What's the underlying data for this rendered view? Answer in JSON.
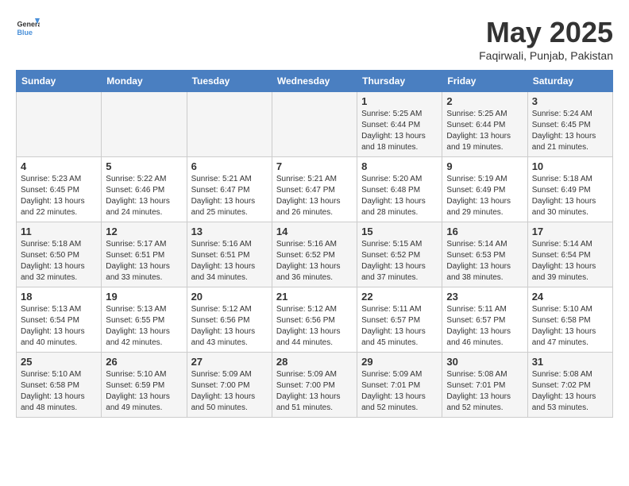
{
  "logo": {
    "line1": "General",
    "line2": "Blue"
  },
  "title": "May 2025",
  "subtitle": "Faqirwali, Punjab, Pakistan",
  "weekdays": [
    "Sunday",
    "Monday",
    "Tuesday",
    "Wednesday",
    "Thursday",
    "Friday",
    "Saturday"
  ],
  "weeks": [
    [
      {
        "day": "",
        "sunrise": "",
        "sunset": "",
        "daylight": ""
      },
      {
        "day": "",
        "sunrise": "",
        "sunset": "",
        "daylight": ""
      },
      {
        "day": "",
        "sunrise": "",
        "sunset": "",
        "daylight": ""
      },
      {
        "day": "",
        "sunrise": "",
        "sunset": "",
        "daylight": ""
      },
      {
        "day": "1",
        "sunrise": "Sunrise: 5:25 AM",
        "sunset": "Sunset: 6:44 PM",
        "daylight": "Daylight: 13 hours and 18 minutes."
      },
      {
        "day": "2",
        "sunrise": "Sunrise: 5:25 AM",
        "sunset": "Sunset: 6:44 PM",
        "daylight": "Daylight: 13 hours and 19 minutes."
      },
      {
        "day": "3",
        "sunrise": "Sunrise: 5:24 AM",
        "sunset": "Sunset: 6:45 PM",
        "daylight": "Daylight: 13 hours and 21 minutes."
      }
    ],
    [
      {
        "day": "4",
        "sunrise": "Sunrise: 5:23 AM",
        "sunset": "Sunset: 6:45 PM",
        "daylight": "Daylight: 13 hours and 22 minutes."
      },
      {
        "day": "5",
        "sunrise": "Sunrise: 5:22 AM",
        "sunset": "Sunset: 6:46 PM",
        "daylight": "Daylight: 13 hours and 24 minutes."
      },
      {
        "day": "6",
        "sunrise": "Sunrise: 5:21 AM",
        "sunset": "Sunset: 6:47 PM",
        "daylight": "Daylight: 13 hours and 25 minutes."
      },
      {
        "day": "7",
        "sunrise": "Sunrise: 5:21 AM",
        "sunset": "Sunset: 6:47 PM",
        "daylight": "Daylight: 13 hours and 26 minutes."
      },
      {
        "day": "8",
        "sunrise": "Sunrise: 5:20 AM",
        "sunset": "Sunset: 6:48 PM",
        "daylight": "Daylight: 13 hours and 28 minutes."
      },
      {
        "day": "9",
        "sunrise": "Sunrise: 5:19 AM",
        "sunset": "Sunset: 6:49 PM",
        "daylight": "Daylight: 13 hours and 29 minutes."
      },
      {
        "day": "10",
        "sunrise": "Sunrise: 5:18 AM",
        "sunset": "Sunset: 6:49 PM",
        "daylight": "Daylight: 13 hours and 30 minutes."
      }
    ],
    [
      {
        "day": "11",
        "sunrise": "Sunrise: 5:18 AM",
        "sunset": "Sunset: 6:50 PM",
        "daylight": "Daylight: 13 hours and 32 minutes."
      },
      {
        "day": "12",
        "sunrise": "Sunrise: 5:17 AM",
        "sunset": "Sunset: 6:51 PM",
        "daylight": "Daylight: 13 hours and 33 minutes."
      },
      {
        "day": "13",
        "sunrise": "Sunrise: 5:16 AM",
        "sunset": "Sunset: 6:51 PM",
        "daylight": "Daylight: 13 hours and 34 minutes."
      },
      {
        "day": "14",
        "sunrise": "Sunrise: 5:16 AM",
        "sunset": "Sunset: 6:52 PM",
        "daylight": "Daylight: 13 hours and 36 minutes."
      },
      {
        "day": "15",
        "sunrise": "Sunrise: 5:15 AM",
        "sunset": "Sunset: 6:52 PM",
        "daylight": "Daylight: 13 hours and 37 minutes."
      },
      {
        "day": "16",
        "sunrise": "Sunrise: 5:14 AM",
        "sunset": "Sunset: 6:53 PM",
        "daylight": "Daylight: 13 hours and 38 minutes."
      },
      {
        "day": "17",
        "sunrise": "Sunrise: 5:14 AM",
        "sunset": "Sunset: 6:54 PM",
        "daylight": "Daylight: 13 hours and 39 minutes."
      }
    ],
    [
      {
        "day": "18",
        "sunrise": "Sunrise: 5:13 AM",
        "sunset": "Sunset: 6:54 PM",
        "daylight": "Daylight: 13 hours and 40 minutes."
      },
      {
        "day": "19",
        "sunrise": "Sunrise: 5:13 AM",
        "sunset": "Sunset: 6:55 PM",
        "daylight": "Daylight: 13 hours and 42 minutes."
      },
      {
        "day": "20",
        "sunrise": "Sunrise: 5:12 AM",
        "sunset": "Sunset: 6:56 PM",
        "daylight": "Daylight: 13 hours and 43 minutes."
      },
      {
        "day": "21",
        "sunrise": "Sunrise: 5:12 AM",
        "sunset": "Sunset: 6:56 PM",
        "daylight": "Daylight: 13 hours and 44 minutes."
      },
      {
        "day": "22",
        "sunrise": "Sunrise: 5:11 AM",
        "sunset": "Sunset: 6:57 PM",
        "daylight": "Daylight: 13 hours and 45 minutes."
      },
      {
        "day": "23",
        "sunrise": "Sunrise: 5:11 AM",
        "sunset": "Sunset: 6:57 PM",
        "daylight": "Daylight: 13 hours and 46 minutes."
      },
      {
        "day": "24",
        "sunrise": "Sunrise: 5:10 AM",
        "sunset": "Sunset: 6:58 PM",
        "daylight": "Daylight: 13 hours and 47 minutes."
      }
    ],
    [
      {
        "day": "25",
        "sunrise": "Sunrise: 5:10 AM",
        "sunset": "Sunset: 6:58 PM",
        "daylight": "Daylight: 13 hours and 48 minutes."
      },
      {
        "day": "26",
        "sunrise": "Sunrise: 5:10 AM",
        "sunset": "Sunset: 6:59 PM",
        "daylight": "Daylight: 13 hours and 49 minutes."
      },
      {
        "day": "27",
        "sunrise": "Sunrise: 5:09 AM",
        "sunset": "Sunset: 7:00 PM",
        "daylight": "Daylight: 13 hours and 50 minutes."
      },
      {
        "day": "28",
        "sunrise": "Sunrise: 5:09 AM",
        "sunset": "Sunset: 7:00 PM",
        "daylight": "Daylight: 13 hours and 51 minutes."
      },
      {
        "day": "29",
        "sunrise": "Sunrise: 5:09 AM",
        "sunset": "Sunset: 7:01 PM",
        "daylight": "Daylight: 13 hours and 52 minutes."
      },
      {
        "day": "30",
        "sunrise": "Sunrise: 5:08 AM",
        "sunset": "Sunset: 7:01 PM",
        "daylight": "Daylight: 13 hours and 52 minutes."
      },
      {
        "day": "31",
        "sunrise": "Sunrise: 5:08 AM",
        "sunset": "Sunset: 7:02 PM",
        "daylight": "Daylight: 13 hours and 53 minutes."
      }
    ]
  ]
}
